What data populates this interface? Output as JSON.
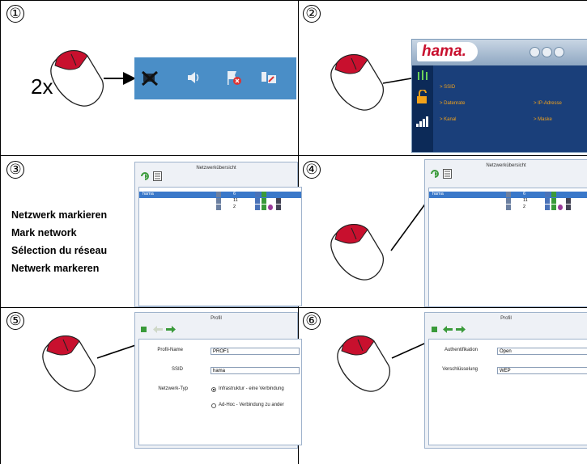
{
  "steps": [
    {
      "number": "①"
    },
    {
      "number": "②"
    },
    {
      "number": "③"
    },
    {
      "number": "④"
    },
    {
      "number": "⑤"
    },
    {
      "number": "⑥"
    }
  ],
  "step1": {
    "click_count": "2x",
    "taskbar_icons": [
      "network-disabled-icon",
      "speaker-icon",
      "shield-flag-icon",
      "network-adapter-icon"
    ]
  },
  "step2": {
    "brand": "hama.",
    "items_left": [
      "SSID",
      "Datenrate",
      "Kanal"
    ],
    "items_right": [
      "IP-Adresse",
      "Maske"
    ]
  },
  "step3": {
    "instructions": [
      "Netzwerk markieren",
      "Mark network",
      "Sélection du réseau",
      "Netwerk markeren"
    ],
    "panel_title": "Netzwerkübersicht",
    "rows": [
      {
        "ssid": "hama",
        "channel": "6",
        "selected": true
      },
      {
        "ssid": "",
        "channel": "11",
        "selected": false
      },
      {
        "ssid": "",
        "channel": "2",
        "selected": false
      }
    ]
  },
  "step4": {
    "panel_title": "Netzwerkübersicht",
    "rows": [
      {
        "ssid": "hama",
        "channel": "6",
        "selected": true
      },
      {
        "ssid": "",
        "channel": "11",
        "selected": false
      },
      {
        "ssid": "",
        "channel": "2",
        "selected": false
      }
    ]
  },
  "step5": {
    "panel_title": "Profil",
    "profile_name_label": "Profil-Name",
    "profile_name_value": "PROF1",
    "ssid_label": "SSID",
    "ssid_value": "hama",
    "network_type_label": "Netzwerk-Typ",
    "option_infrastructure": "Infrastruktur - eine Verbindung",
    "option_adhoc": "Ad-Hoc - Verbindung zu ander"
  },
  "step6": {
    "panel_title": "Profil",
    "auth_label": "Authentifikation",
    "auth_value": "Open",
    "encryption_label": "Verschlüsselung",
    "encryption_value": "WEP"
  }
}
